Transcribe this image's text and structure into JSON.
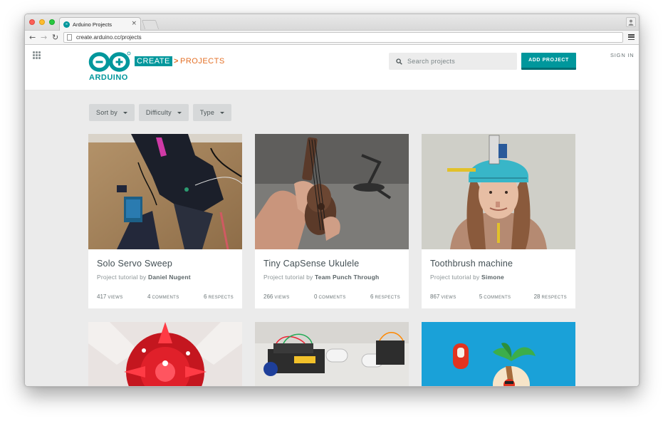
{
  "browser": {
    "tab_title": "Arduino Projects",
    "tab_close": "×",
    "url": "create.arduino.cc/projects"
  },
  "header": {
    "logo_text": "ARDUINO",
    "create_label": "CREATE",
    "separator": ">",
    "section_label": "PROJECTS",
    "search_placeholder": "Search projects",
    "add_project_label": "ADD PROJECT",
    "sign_in_label": "SIGN IN"
  },
  "filters": [
    {
      "label": "Sort by"
    },
    {
      "label": "Difficulty"
    },
    {
      "label": "Type"
    }
  ],
  "cards": [
    {
      "title": "Solo Servo Sweep",
      "subtitle_prefix": "Project tutorial by",
      "author": "Daniel Nugent",
      "views": "417",
      "views_label": "VIEWS",
      "comments": "4",
      "comments_label": "COMMENTS",
      "respects": "6",
      "respects_label": "RESPECTS"
    },
    {
      "title": "Tiny CapSense Ukulele",
      "subtitle_prefix": "Project tutorial by",
      "author": "Team Punch Through",
      "views": "266",
      "views_label": "VIEWS",
      "comments": "0",
      "comments_label": "COMMENTS",
      "respects": "6",
      "respects_label": "RESPECTS"
    },
    {
      "title": "Toothbrush machine",
      "subtitle_prefix": "Project tutorial by",
      "author": "Simone",
      "views": "867",
      "views_label": "VIEWS",
      "comments": "5",
      "comments_label": "COMMENTS",
      "respects": "28",
      "respects_label": "RESPECTS"
    }
  ],
  "colors": {
    "brand_teal": "#00979c",
    "brand_orange": "#e47128"
  }
}
